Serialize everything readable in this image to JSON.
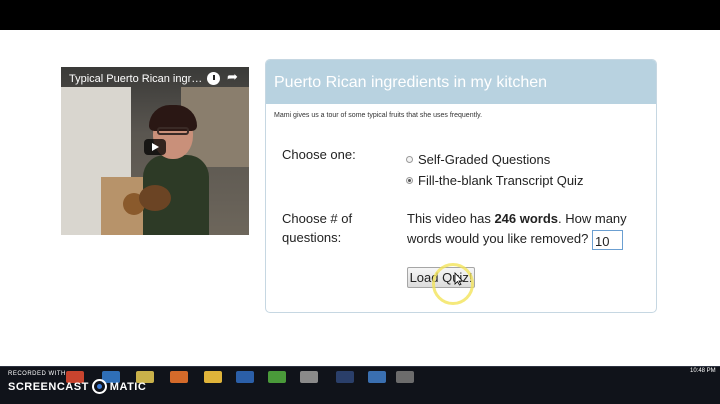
{
  "video": {
    "title": "Typical Puerto Rican ingredie...",
    "clock_icon": "watch-later-icon",
    "share_icon": "share-icon",
    "play_icon": "play-icon"
  },
  "panel": {
    "title": "Puerto Rican ingredients in my kitchen",
    "description": "Mami gives us a tour of some typical fruits that she uses frequently.",
    "choose_label": "Choose one:",
    "options": [
      {
        "label": "Self-Graded Questions",
        "checked": false
      },
      {
        "label": "Fill-the-blank Transcript Quiz",
        "checked": true
      }
    ],
    "num_label_line1": "Choose # of",
    "num_label_line2": "questions:",
    "words_prefix": "This video has ",
    "word_count": "246 words",
    "words_suffix": ". How many words would you like removed?",
    "removed_value": "10",
    "load_button": "Load Quiz!"
  },
  "watermark": {
    "recorded": "RECORDED WITH",
    "brand_left": "SCREENCAST",
    "brand_right": "MATIC"
  },
  "taskbar": {
    "clock": "10:48 PM"
  },
  "colors": {
    "panel_header": "#b8d2e0",
    "input_border": "#6b9fd1"
  }
}
